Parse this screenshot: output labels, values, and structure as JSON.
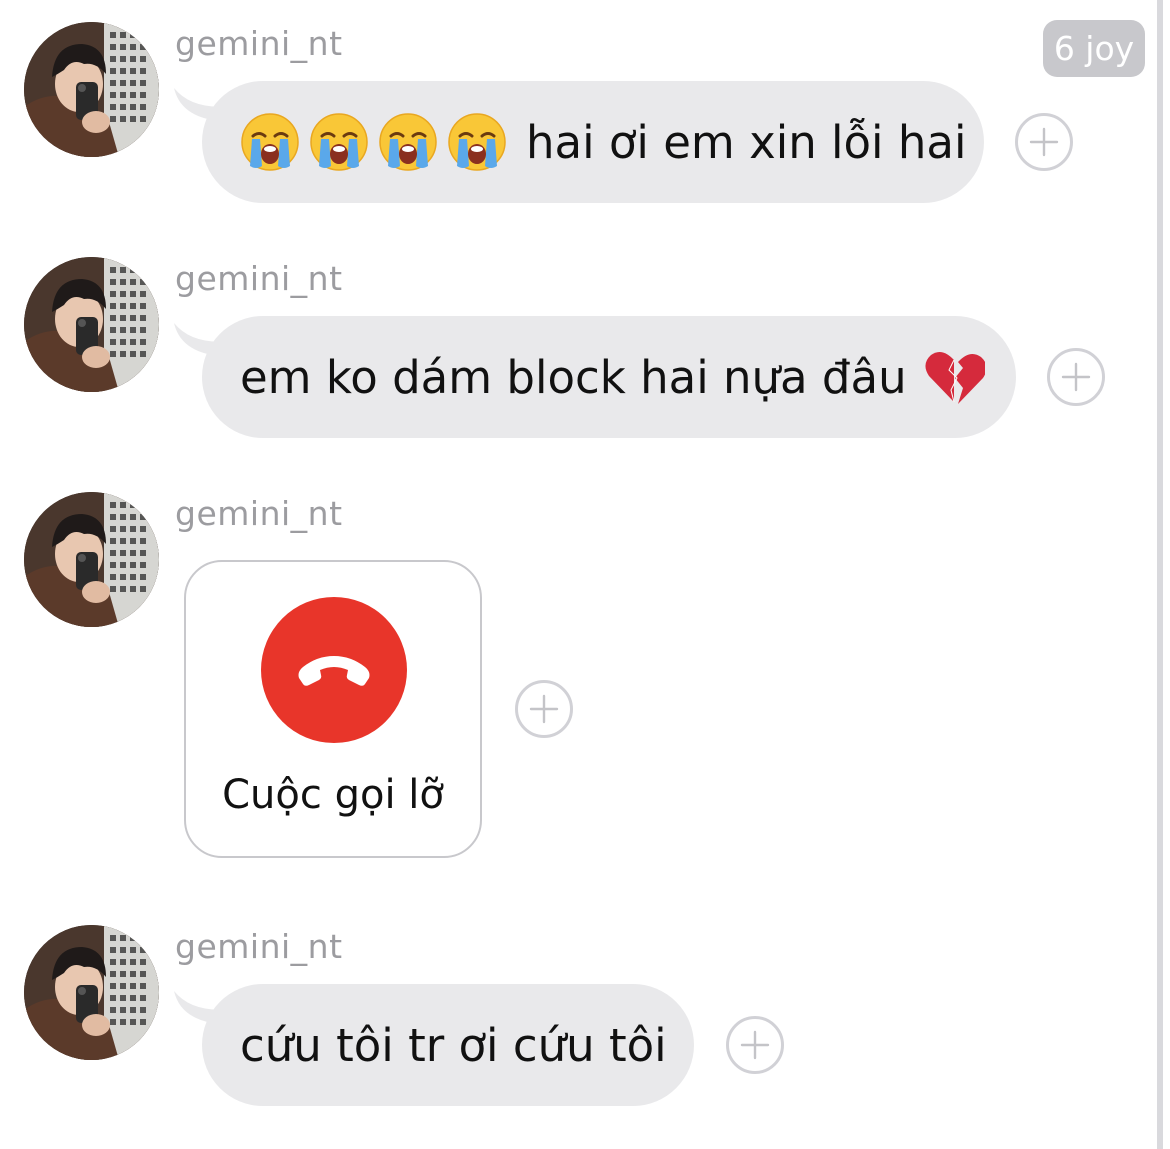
{
  "timestamp_badge": "6 joy",
  "colors": {
    "bubble": "#e9e9eb",
    "missed_call_red": "#e8352a",
    "username_gray": "#9c9ca0"
  },
  "messages": [
    {
      "sender": "gemini_nt",
      "emojis": [
        "loudly-crying-face",
        "loudly-crying-face",
        "loudly-crying-face",
        "loudly-crying-face"
      ],
      "text": "hai ơi em xin lỗi hai"
    },
    {
      "sender": "gemini_nt",
      "text": "em ko dám block hai nựa đâu",
      "trailing_emoji": "broken-heart"
    },
    {
      "sender": "gemini_nt",
      "call": {
        "icon": "hang-up-phone-icon",
        "label": "Cuộc gọi lỡ"
      }
    },
    {
      "sender": "gemini_nt",
      "text": "cứu tôi tr ơi cứu tôi"
    }
  ]
}
